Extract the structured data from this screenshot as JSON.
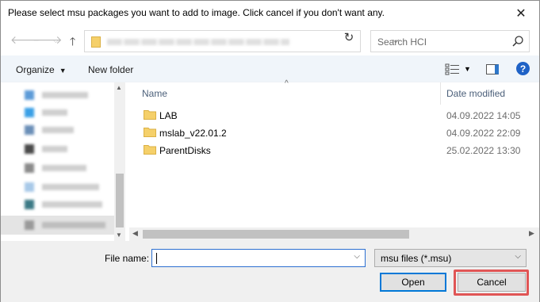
{
  "window": {
    "title": "Please select msu packages you want to add to image. Click cancel if you don't want any."
  },
  "navigation": {
    "back_icon": "arrow-left-icon",
    "forward_icon": "arrow-right-icon",
    "up_icon": "arrow-up-icon",
    "refresh_icon": "refresh-icon"
  },
  "search": {
    "placeholder": "Search HCI"
  },
  "toolbar": {
    "organize_label": "Organize",
    "new_folder_label": "New folder"
  },
  "columns": {
    "name": "Name",
    "date_modified": "Date modified"
  },
  "files": [
    {
      "name": "LAB",
      "date": "04.09.2022 14:05"
    },
    {
      "name": "mslab_v22.01.2",
      "date": "04.09.2022 22:09"
    },
    {
      "name": "ParentDisks",
      "date": "25.02.2022 13:30"
    }
  ],
  "bottom": {
    "file_name_label": "File name:",
    "file_name_value": "",
    "filter_value": "msu files (*.msu)",
    "open_label": "Open",
    "cancel_label": "Cancel"
  },
  "colors": {
    "accent": "#0078d7",
    "highlight": "#e05555",
    "folder": "#f5d06a"
  }
}
